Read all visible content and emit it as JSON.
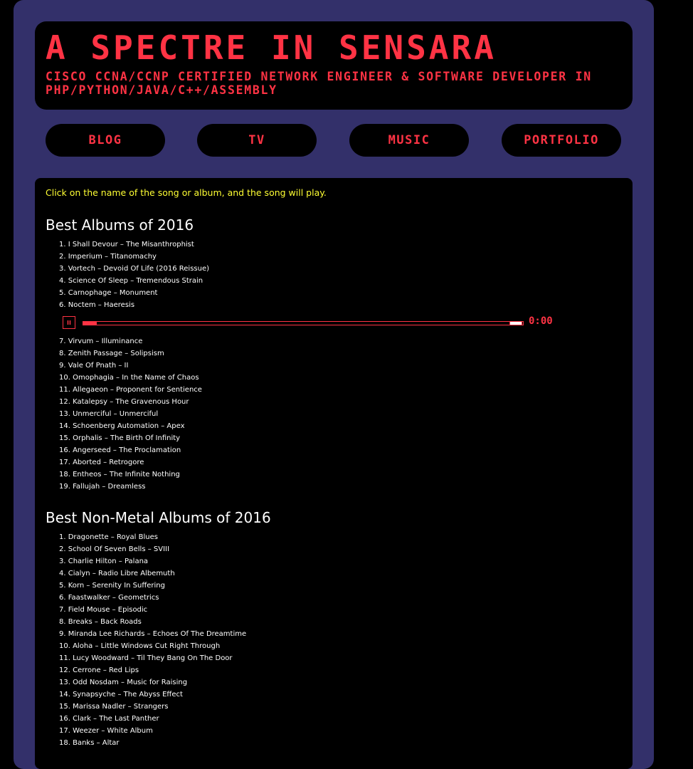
{
  "header": {
    "title": "A SPECTRE IN SENSARA",
    "subtitle": "CISCO CCNA/CCNP CERTIFIED NETWORK ENGINEER & SOFTWARE DEVELOPER IN PHP/PYTHON/JAVA/C++/ASSEMBLY"
  },
  "nav": {
    "items": [
      {
        "label": "BLOG"
      },
      {
        "label": "TV"
      },
      {
        "label": "MUSIC"
      },
      {
        "label": "PORTFOLIO"
      }
    ]
  },
  "content": {
    "instruction": "Click on the name of the song or album, and the song will play.",
    "sections": [
      {
        "title": "Best Albums of 2016",
        "items": [
          "1. I Shall Devour – The Misanthrophist",
          "2. Imperium – Titanomachy",
          "3. Vortech – Devoid Of Life (2016 Reissue)",
          "4. Science Of Sleep – Tremendous Strain",
          "5. Carnophage – Monument",
          "6. Noctem – Haeresis",
          "7. Virvum – Illuminance",
          "8. Zenith Passage – Solipsism",
          "9. Vale Of Pnath – II",
          "10. Omophagia – In the Name of Chaos",
          "11. Allegaeon – Proponent for Sentience",
          "12. Katalepsy – The Gravenous Hour",
          "13. Unmerciful – Unmerciful",
          "14. Schoenberg Automation – Apex",
          "15. Orphalis – The Birth Of Infinity",
          "16. Angerseed – The Proclamation",
          "17. Aborted – Retrogore",
          "18. Entheos – The Infinite Nothing",
          "19. Fallujah – Dreamless"
        ]
      },
      {
        "title": "Best Non-Metal Albums of 2016",
        "items": [
          "1. Dragonette – Royal Blues",
          "2. School Of Seven Bells – SVIII",
          "3. Charlie Hilton – Palana",
          "4. Cialyn – Radio Libre Albemuth",
          "5. Korn – Serenity In Suffering",
          "6. Faastwalker – Geometrics",
          "7. Field Mouse – Episodic",
          "8. Breaks – Back Roads",
          "9. Miranda Lee Richards – Echoes Of The Dreamtime",
          "10. Aloha – Little Windows Cut Right Through",
          "11. Lucy Woodward – Til They Bang On The Door",
          "12. Cerrone – Red Lips",
          "13. Odd Nosdam – Music for Raising",
          "14. Synapsyche – The Abyss Effect",
          "15. Marissa Nadler – Strangers",
          "16. Clark – The Last Panther",
          "17. Weezer – White Album",
          "18. Banks – Altar"
        ]
      }
    ]
  },
  "player": {
    "state_icon": "pause-icon",
    "pause_glyph": "II",
    "time": "0:00",
    "progress_fraction": 0.03,
    "volume_fraction": 1.0
  },
  "colors": {
    "frame": "#33306a",
    "accent": "#ff3344",
    "instruction": "#ffff33",
    "panel": "#000000"
  }
}
